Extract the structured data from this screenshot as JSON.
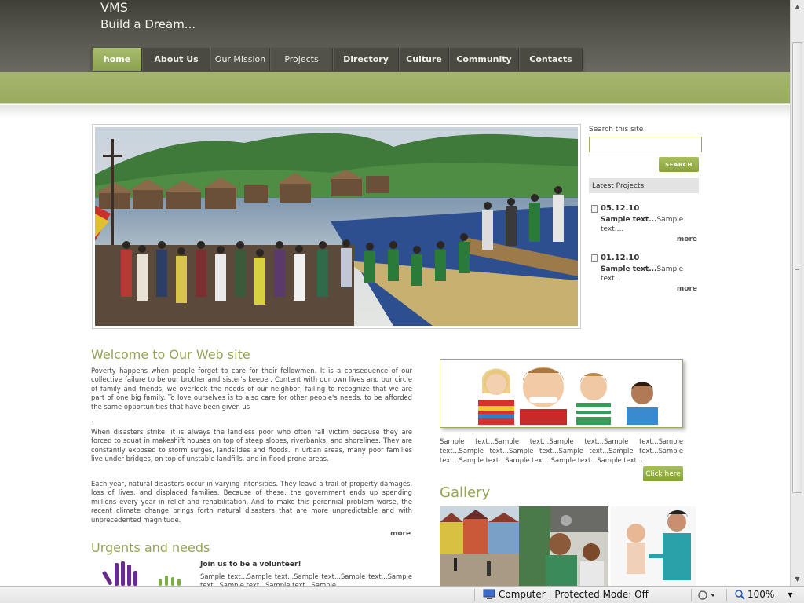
{
  "site": {
    "title": "VMS",
    "tagline": "Build a Dream..."
  },
  "nav": [
    {
      "label": "home",
      "active": true
    },
    {
      "label": "About Us"
    },
    {
      "label": "Our Mission"
    },
    {
      "label": "Projects"
    },
    {
      "label": "Directory"
    },
    {
      "label": "Culture"
    },
    {
      "label": "Community"
    },
    {
      "label": "Contacts"
    }
  ],
  "sidebar": {
    "search_label": "Search this site",
    "search_button": "SEARCH",
    "latest_heading": "Latest Projects",
    "projects": [
      {
        "date": "05.12.10",
        "bold": "Sample text...",
        "text": "Sample text....",
        "more": "more"
      },
      {
        "date": "01.12.10",
        "bold": "Sample text...",
        "text": "Sample text...",
        "more": "more"
      }
    ]
  },
  "welcome": {
    "heading": "Welcome to Our Web site",
    "p1": "Poverty happens when people forget to care for their fellowmen. It is a consequence of our collective failure to be our brother and sister's keeper. Content with our own lives and our circle of family and friends, we overlook the needs of our neighbor, failing to recognize that we are part of one big family. To love ourselves is to also care for other people's needs, to be afforded the same opportunities that have been given us",
    "p1_tail": ".",
    "p2": "When disasters strike, it is always the landless poor who often fall victim because they are forced to squat in makeshift houses on top of steep slopes, riverbanks, and shorelines. They are constantly exposed to storm surges, landslides and floods. In urban areas, many poor families live under bridges, on top of unstable landfills, and in flood prone areas.",
    "p3": "Each year, natural disasters occur in varying intensities. They leave a trail of property damages, loss of lives, and displaced families. Because of these, the government ends up spending millions every year in relief and rehabilitation. And to make this perennial problem worse, the recent climate change brings forth natural disasters that are more unpredictable and with unprecedented magnitude.",
    "more": "more"
  },
  "urgents": {
    "heading": "Urgents and needs",
    "volunteer_title": "Join us to be a volunteer!",
    "volunteer_text": "Sample text...Sample text...Sample text...Sample text...Sample text...Sample text...Sample text...Sample"
  },
  "kids": {
    "text": "Sample text...Sample text...Sample text...Sample text...Sample text...Sample text...Sample text...Sample text...Sample text...Sample text...Sample text...Sample text...Sample text...Sample text...",
    "button": "Click here"
  },
  "gallery": {
    "heading": "Gallery"
  },
  "statusbar": {
    "zone": "Computer | Protected Mode: Off",
    "zoom": "100%"
  },
  "colors": {
    "accent_green": "#99ab5f",
    "header_dark": "#4a4a43",
    "heading_green": "#93a456"
  }
}
